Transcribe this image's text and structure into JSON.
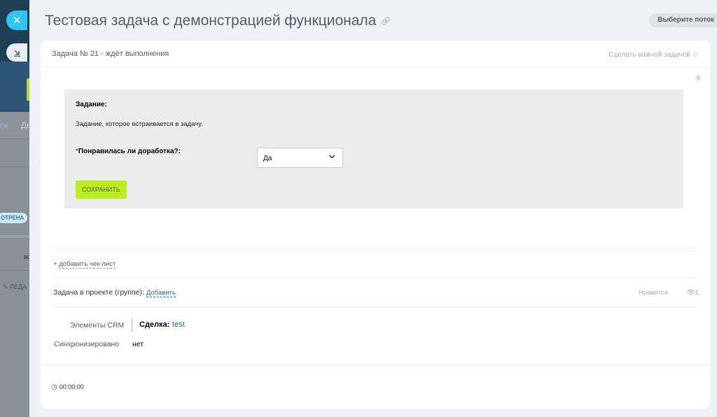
{
  "window": {
    "title": "Тестовая задача с демонстрацией функционала",
    "flow_button": "Выберите поток"
  },
  "background": {
    "tab_ok": "ок",
    "tab_de": "Де",
    "badge": "ОТРЕНА",
    "vs": "вс",
    "edit": "✎ РЕДА"
  },
  "task": {
    "header": "Задача № 21 - ждёт выполнения",
    "important": "Сделать важной задачей",
    "form": {
      "section_label": "Задание:",
      "description": "Задание, которое встраивается в задачу.",
      "required_mark": "*",
      "question_label": "Понравилась ли доработка?:",
      "answer_selected": "Да",
      "save_label": "СОХРАНИТЬ"
    },
    "checklist_link": "добавить чек-лист",
    "checklist_plus": "+",
    "project_label": "Задача в проекте (группе):",
    "project_add": "Добавить",
    "likes_label": "Нравится",
    "views_count": "1",
    "crm": {
      "label": "Элементы CRM",
      "deal_label": "Сделка:",
      "deal_value": "test"
    },
    "sync": {
      "label": "Синхронизировано",
      "value": "нет"
    },
    "timer": "00:00:00"
  },
  "colors": {
    "accent_blue": "#2fc6f6",
    "save_lime": "#bbed21",
    "link_blue": "#2067b0",
    "required_red": "#e53935"
  }
}
